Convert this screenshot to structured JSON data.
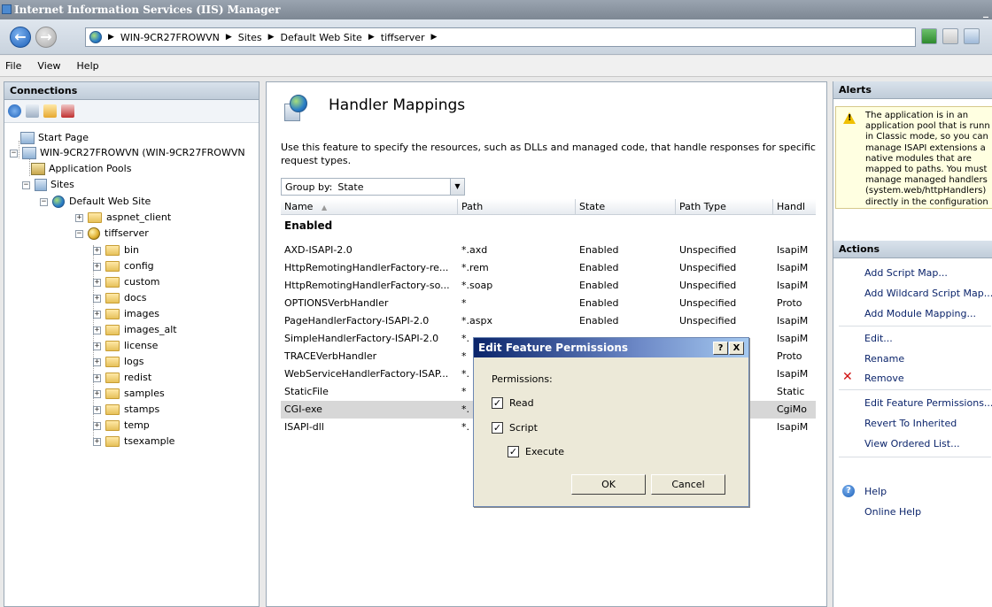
{
  "window": {
    "title": "Internet Information Services (IIS) Manager",
    "minimize_glyph": "_"
  },
  "address": {
    "crumbs": [
      "WIN-9CR27FROWVN",
      "Sites",
      "Default Web Site",
      "tiffserver"
    ],
    "separator": "▶"
  },
  "menu": {
    "items": [
      "File",
      "View",
      "Help"
    ]
  },
  "connections": {
    "title": "Connections",
    "tree": {
      "start_page": "Start Page",
      "server": "WIN-9CR27FROWVN (WIN-9CR27FROWVN",
      "app_pools": "Application Pools",
      "sites": "Sites",
      "default_site": "Default Web Site",
      "aspnet_client": "aspnet_client",
      "tiffserver": "tiffserver",
      "folders": [
        "bin",
        "config",
        "custom",
        "docs",
        "images",
        "images_alt",
        "license",
        "logs",
        "redist",
        "samples",
        "stamps",
        "temp",
        "tsexample"
      ]
    }
  },
  "feature": {
    "title": "Handler Mappings",
    "description": "Use this feature to specify the resources, such as DLLs and managed code, that handle responses for specific request types.",
    "group_by_label": "Group by:",
    "group_by_value": "State",
    "columns": [
      "Name",
      "Path",
      "State",
      "Path Type",
      "Handl"
    ],
    "sort_glyph": "▲",
    "group_name": "Enabled",
    "rows": [
      {
        "name": "AXD-ISAPI-2.0",
        "path": "*.axd",
        "state": "Enabled",
        "path_type": "Unspecified",
        "handler": "IsapiM"
      },
      {
        "name": "HttpRemotingHandlerFactory-re...",
        "path": "*.rem",
        "state": "Enabled",
        "path_type": "Unspecified",
        "handler": "IsapiM"
      },
      {
        "name": "HttpRemotingHandlerFactory-so...",
        "path": "*.soap",
        "state": "Enabled",
        "path_type": "Unspecified",
        "handler": "IsapiM"
      },
      {
        "name": "OPTIONSVerbHandler",
        "path": "*",
        "state": "Enabled",
        "path_type": "Unspecified",
        "handler": "Proto"
      },
      {
        "name": "PageHandlerFactory-ISAPI-2.0",
        "path": "*.aspx",
        "state": "Enabled",
        "path_type": "Unspecified",
        "handler": "IsapiM"
      },
      {
        "name": "SimpleHandlerFactory-ISAPI-2.0",
        "path": "*.",
        "state": "",
        "path_type": "",
        "handler": "IsapiM"
      },
      {
        "name": "TRACEVerbHandler",
        "path": "*",
        "state": "",
        "path_type": "",
        "handler": "Proto"
      },
      {
        "name": "WebServiceHandlerFactory-ISAP...",
        "path": "*.",
        "state": "",
        "path_type": "",
        "handler": "IsapiM"
      },
      {
        "name": "StaticFile",
        "path": "*",
        "state": "",
        "path_type": "",
        "handler": "Static"
      },
      {
        "name": "CGI-exe",
        "path": "*.",
        "state": "",
        "path_type": "",
        "handler": "CgiMo"
      },
      {
        "name": "ISAPI-dll",
        "path": "*.",
        "state": "",
        "path_type": "",
        "handler": "IsapiM"
      }
    ]
  },
  "dialog": {
    "title": "Edit Feature Permissions",
    "help_glyph": "?",
    "close_glyph": "X",
    "permissions_label": "Permissions:",
    "read": "Read",
    "script": "Script",
    "execute": "Execute",
    "ok": "OK",
    "cancel": "Cancel",
    "check_glyph": "✓"
  },
  "alerts": {
    "title": "Alerts",
    "lines": [
      "The application is in an",
      "application pool that is runn",
      "in Classic mode, so you can",
      "manage ISAPI extensions a",
      "native modules that are",
      "mapped to paths. You must",
      "manage managed handlers",
      "(system.web/httpHandlers)",
      "directly in the configuration"
    ]
  },
  "actions": {
    "title": "Actions",
    "add_script_map": "Add Script Map...",
    "add_wildcard": "Add Wildcard Script Map...",
    "add_module": "Add Module Mapping...",
    "edit": "Edit...",
    "rename": "Rename",
    "remove": "Remove",
    "edit_feature_perms": "Edit Feature Permissions...",
    "revert": "Revert To Inherited",
    "view_ordered": "View Ordered List...",
    "help": "Help",
    "online_help": "Online Help",
    "remove_glyph": "✕",
    "help_glyph": "?"
  }
}
